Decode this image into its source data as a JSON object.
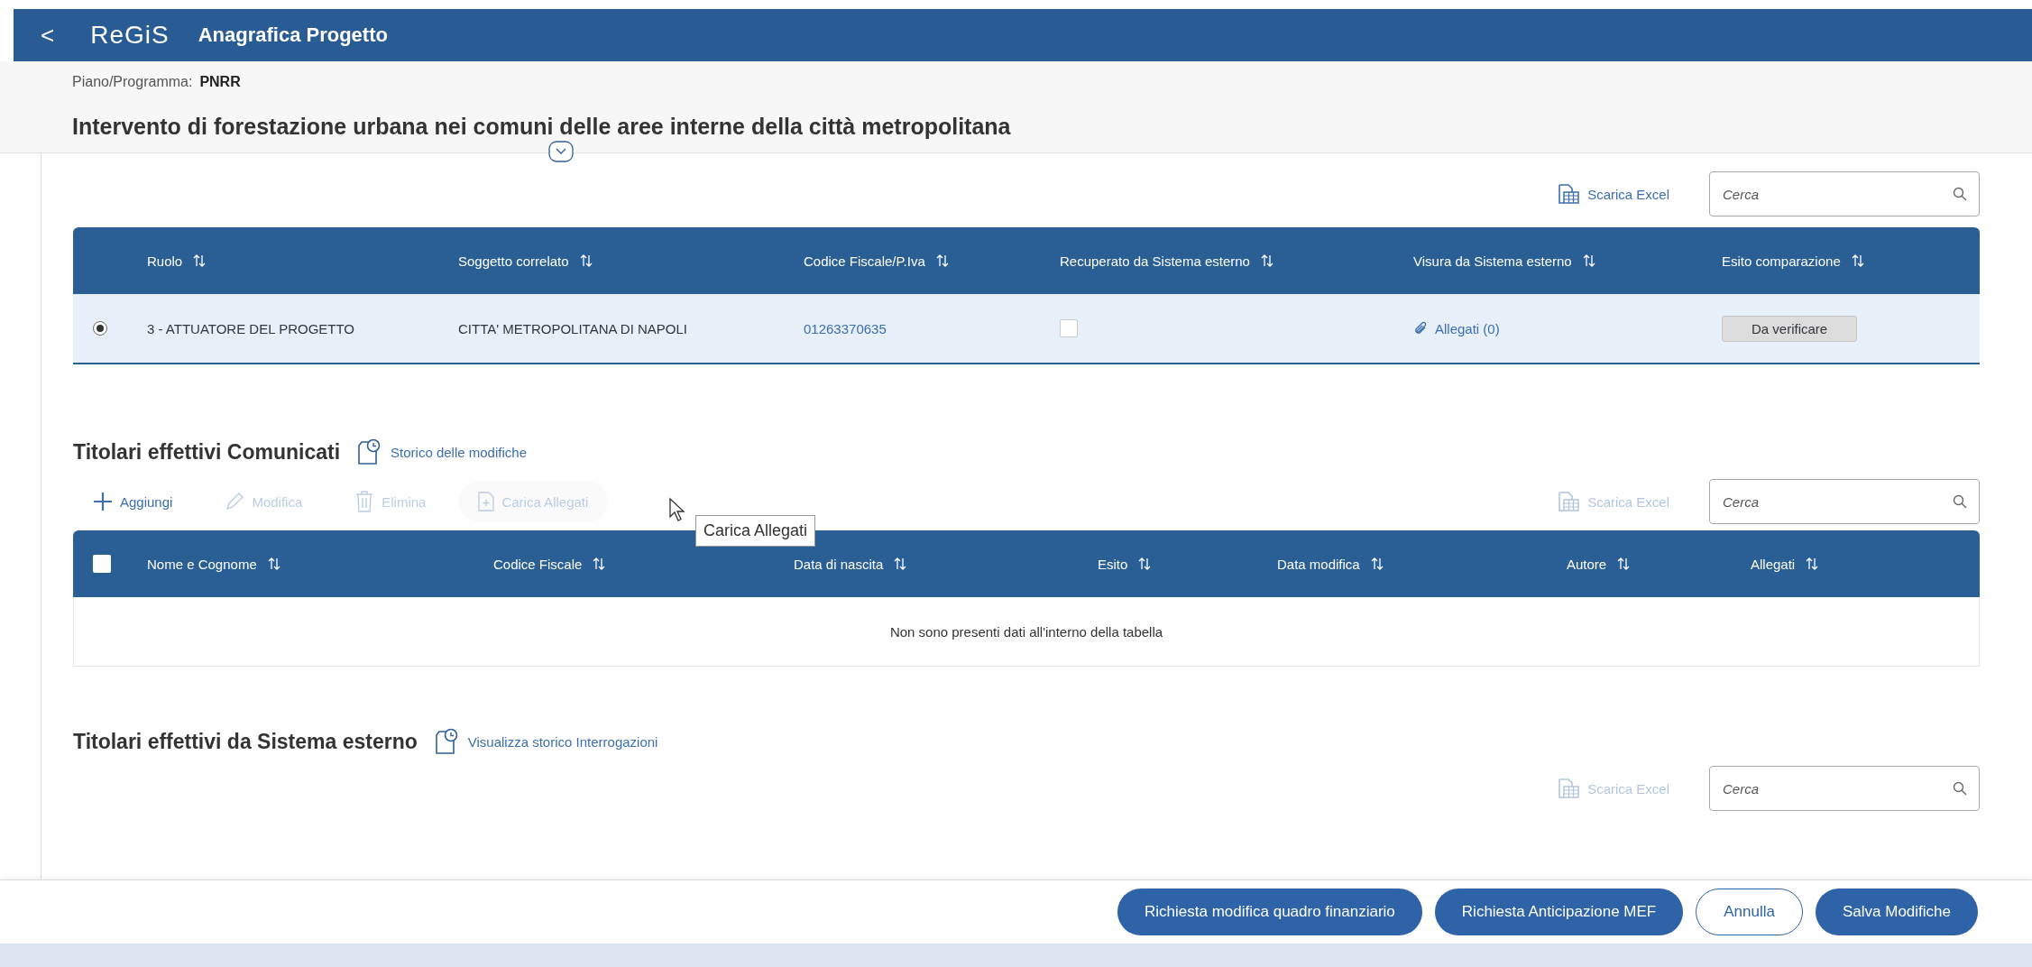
{
  "header": {
    "back": "<",
    "logo": "ReGiS",
    "title": "Anagrafica Progetto"
  },
  "program": {
    "label": "Piano/Programma:",
    "value": "PNRR"
  },
  "project_title": "Intervento di forestazione urbana nei comuni delle aree interne della città metropolitana",
  "subjects": {
    "excel": {
      "label": "Scarica Excel",
      "disabled": false
    },
    "search": {
      "placeholder": "Cerca"
    },
    "columns": [
      "Ruolo",
      "Soggetto correlato",
      "Codice Fiscale/P.Iva",
      "Recuperato da Sistema esterno",
      "Visura da Sistema esterno",
      "Esito comparazione"
    ],
    "rows": [
      {
        "selected": true,
        "role": "3 - ATTUATORE DEL PROGETTO",
        "subject": "CITTA' METROPOLITANA DI NAPOLI",
        "tax_code": "01263370635",
        "retrieved": false,
        "attachments": "Allegati (0)",
        "outcome": "Da verificare"
      }
    ]
  },
  "declared_owners": {
    "title": "Titolari effettivi Comunicati",
    "history_link": "Storico delle modifiche",
    "actions": [
      {
        "kind": "add",
        "label": "Aggiungi",
        "disabled": false,
        "hovered": false
      },
      {
        "kind": "edit",
        "label": "Modifica",
        "disabled": true,
        "hovered": false
      },
      {
        "kind": "delete",
        "label": "Elimina",
        "disabled": true,
        "hovered": false
      },
      {
        "kind": "upload",
        "label": "Carica Allegati",
        "disabled": true,
        "hovered": true
      }
    ],
    "tooltip": "Carica Allegati",
    "excel": {
      "label": "Scarica Excel",
      "disabled": true
    },
    "search": {
      "placeholder": "Cerca"
    },
    "select_all": false,
    "columns": [
      "Nome e Cognome",
      "Codice Fiscale",
      "Data di nascita",
      "Esito",
      "Data modifica",
      "Autore",
      "Allegati"
    ],
    "empty_message": "Non sono presenti dati all'interno della tabella"
  },
  "external_owners": {
    "title": "Titolari effettivi da Sistema esterno",
    "history_link": "Visualizza storico Interrogazioni",
    "excel": {
      "label": "Scarica Excel",
      "disabled": true
    },
    "search": {
      "placeholder": "Cerca"
    }
  },
  "footer": {
    "buttons": [
      {
        "label": "Richiesta modifica quadro finanziario",
        "kind": "primary"
      },
      {
        "label": "Richiesta Anticipazione MEF",
        "kind": "primary"
      },
      {
        "label": "Annulla",
        "kind": "outline"
      },
      {
        "label": "Salva Modifiche",
        "kind": "primary"
      }
    ]
  }
}
